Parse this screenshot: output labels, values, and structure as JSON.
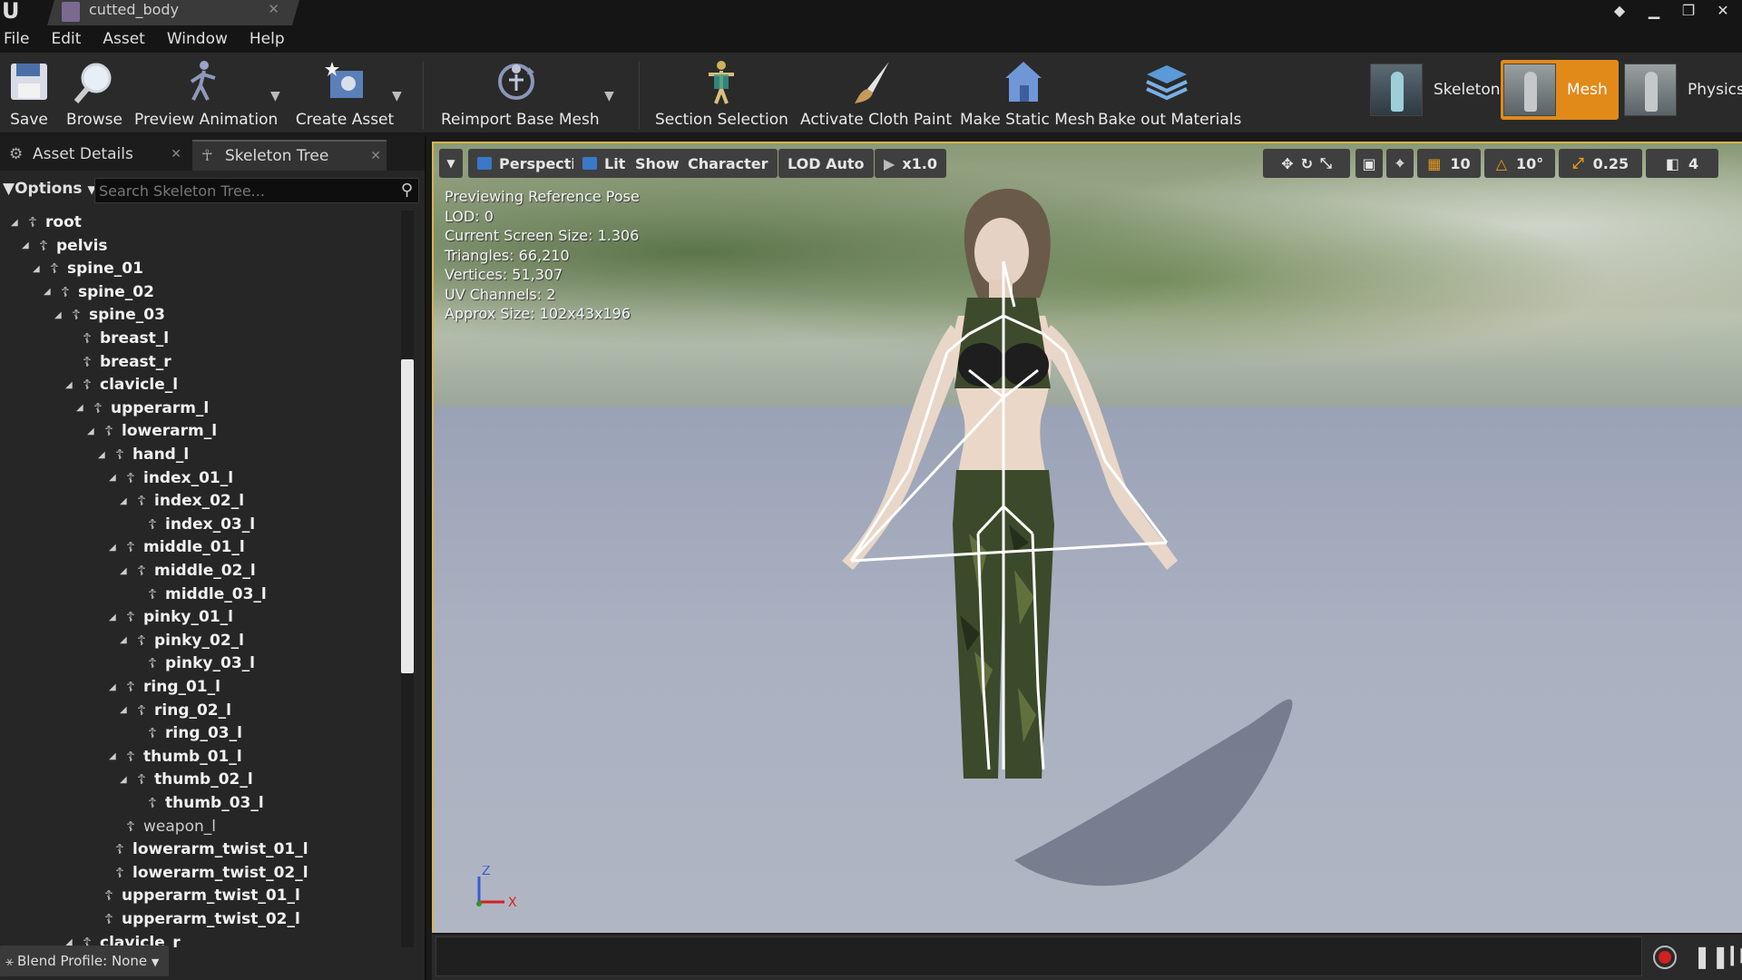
{
  "window": {
    "tab_title": "cutted_body"
  },
  "menu": [
    "File",
    "Edit",
    "Asset",
    "Window",
    "Help"
  ],
  "toolbar": {
    "save": "Save",
    "browse": "Browse",
    "preview_animation": "Preview Animation",
    "create_asset": "Create Asset",
    "reimport_base_mesh": "Reimport Base Mesh",
    "section_selection": "Section Selection",
    "activate_cloth_paint": "Activate Cloth Paint",
    "make_static_mesh": "Make Static Mesh",
    "bake_out_materials": "Bake out Materials",
    "modes": {
      "skeleton": "Skeleton",
      "mesh": "Mesh",
      "physics": "Physics",
      "active": "Mesh",
      "active_color": "#e18a1a"
    }
  },
  "left_panel": {
    "tabs": [
      "Asset Details",
      "Skeleton Tree"
    ],
    "active_tab": "Skeleton Tree",
    "options_label": "Options",
    "search_placeholder": "Search Skeleton Tree...",
    "tree": [
      {
        "name": "root",
        "depth": 0,
        "expanded": true
      },
      {
        "name": "pelvis",
        "depth": 1,
        "expanded": true
      },
      {
        "name": "spine_01",
        "depth": 2,
        "expanded": true
      },
      {
        "name": "spine_02",
        "depth": 3,
        "expanded": true
      },
      {
        "name": "spine_03",
        "depth": 4,
        "expanded": true
      },
      {
        "name": "breast_l",
        "depth": 5,
        "expanded": null
      },
      {
        "name": "breast_r",
        "depth": 5,
        "expanded": null
      },
      {
        "name": "clavicle_l",
        "depth": 5,
        "expanded": true
      },
      {
        "name": "upperarm_l",
        "depth": 6,
        "expanded": true
      },
      {
        "name": "lowerarm_l",
        "depth": 7,
        "expanded": true
      },
      {
        "name": "hand_l",
        "depth": 8,
        "expanded": true
      },
      {
        "name": "index_01_l",
        "depth": 9,
        "expanded": true
      },
      {
        "name": "index_02_l",
        "depth": 10,
        "expanded": true
      },
      {
        "name": "index_03_l",
        "depth": 11,
        "expanded": null
      },
      {
        "name": "middle_01_l",
        "depth": 9,
        "expanded": true
      },
      {
        "name": "middle_02_l",
        "depth": 10,
        "expanded": true
      },
      {
        "name": "middle_03_l",
        "depth": 11,
        "expanded": null
      },
      {
        "name": "pinky_01_l",
        "depth": 9,
        "expanded": true
      },
      {
        "name": "pinky_02_l",
        "depth": 10,
        "expanded": true
      },
      {
        "name": "pinky_03_l",
        "depth": 11,
        "expanded": null
      },
      {
        "name": "ring_01_l",
        "depth": 9,
        "expanded": true
      },
      {
        "name": "ring_02_l",
        "depth": 10,
        "expanded": true
      },
      {
        "name": "ring_03_l",
        "depth": 11,
        "expanded": null
      },
      {
        "name": "thumb_01_l",
        "depth": 9,
        "expanded": true
      },
      {
        "name": "thumb_02_l",
        "depth": 10,
        "expanded": true
      },
      {
        "name": "thumb_03_l",
        "depth": 11,
        "expanded": null
      },
      {
        "name": "weapon_l",
        "depth": 9,
        "expanded": null,
        "socket": true
      },
      {
        "name": "lowerarm_twist_01_l",
        "depth": 8,
        "expanded": null
      },
      {
        "name": "lowerarm_twist_02_l",
        "depth": 8,
        "expanded": null
      },
      {
        "name": "upperarm_twist_01_l",
        "depth": 7,
        "expanded": null
      },
      {
        "name": "upperarm_twist_02_l",
        "depth": 7,
        "expanded": null
      },
      {
        "name": "clavicle_r",
        "depth": 5,
        "expanded": true
      }
    ],
    "blend_profile": "Blend Profile: None"
  },
  "viewport": {
    "toolbar": {
      "perspective": "Perspective",
      "lit": "Lit",
      "show": "Show",
      "character": "Character",
      "lod": "LOD Auto",
      "speed": "x1.0",
      "grid_snap": "10",
      "rotation_snap": "10°",
      "scale_snap": "0.25",
      "camera_speed": "4"
    },
    "stats": [
      "Previewing Reference Pose",
      "LOD: 0",
      "Current Screen Size: 1.306",
      "Triangles: 66,210",
      "Vertices: 51,307",
      "UV Channels: 2",
      "Approx Size: 102x43x196"
    ],
    "axis": {
      "z": "Z",
      "x": "X"
    }
  },
  "colors": {
    "accent": "#e18a1a",
    "viewport_border": "#d9b34a",
    "record": "#d02020"
  }
}
